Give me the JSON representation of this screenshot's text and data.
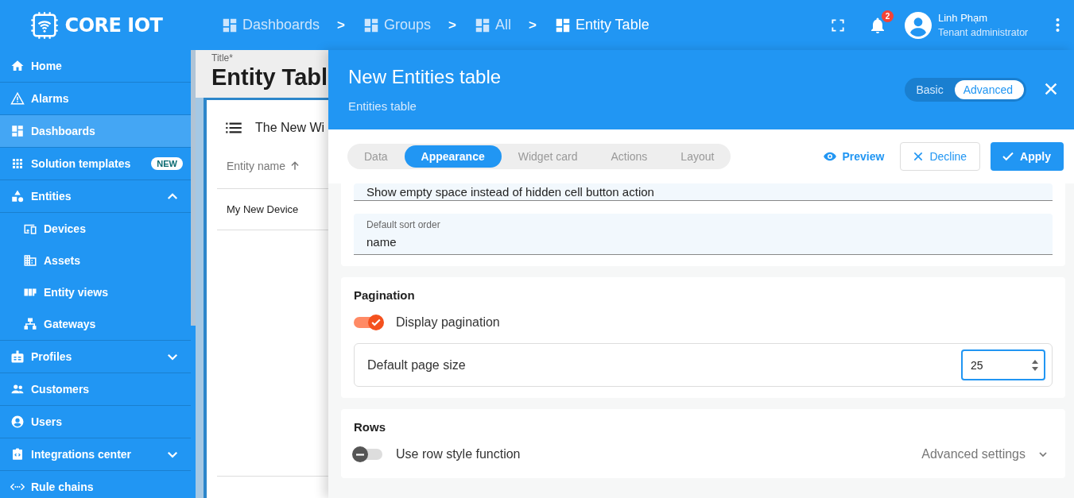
{
  "header": {
    "logo_text": "CORE IOT",
    "breadcrumbs": [
      {
        "label": "Dashboards",
        "current": false
      },
      {
        "label": "Groups",
        "current": false
      },
      {
        "label": "All",
        "current": false
      },
      {
        "label": "Entity Table",
        "current": true
      }
    ],
    "breadcrumb_separators": [
      ">",
      ">",
      ">"
    ],
    "notification_count": "2",
    "user": {
      "name": "Linh Phạm",
      "role": "Tenant administrator"
    }
  },
  "sidebar": {
    "items": [
      {
        "label": "Home",
        "selected": false
      },
      {
        "label": "Alarms",
        "selected": false
      },
      {
        "label": "Dashboards",
        "selected": true
      },
      {
        "label": "Solution templates",
        "selected": false,
        "badge": "NEW"
      },
      {
        "label": "Entities",
        "selected": false,
        "expanded": true,
        "children": [
          {
            "label": "Devices",
            "selected": false
          },
          {
            "label": "Assets",
            "selected": false
          },
          {
            "label": "Entity views",
            "selected": false
          },
          {
            "label": "Gateways",
            "selected": false
          }
        ]
      },
      {
        "label": "Profiles",
        "selected": false,
        "expanded": false
      },
      {
        "label": "Customers",
        "selected": false
      },
      {
        "label": "Users",
        "selected": false
      },
      {
        "label": "Integrations center",
        "selected": false,
        "expanded": false
      },
      {
        "label": "Rule chains",
        "selected": false
      }
    ]
  },
  "editor": {
    "title_label": "Title*",
    "title": "Entity Tabl",
    "widget_title": "The New Wi",
    "columns": [
      {
        "label": "Entity name",
        "sort_ascending": true
      }
    ],
    "rows": [
      [
        "My New Device"
      ]
    ]
  },
  "panel": {
    "title": "New Entities table",
    "subtitle": "Entities table",
    "modes": [
      {
        "label": "Basic",
        "selected": false
      },
      {
        "label": "Advanced",
        "selected": true
      }
    ],
    "tabs": [
      {
        "label": "Data",
        "selected": false
      },
      {
        "label": "Appearance",
        "selected": true
      },
      {
        "label": "Widget card",
        "selected": false
      },
      {
        "label": "Actions",
        "selected": false
      },
      {
        "label": "Layout",
        "selected": false
      }
    ],
    "actions": [
      {
        "label": "Preview",
        "kind": "link"
      },
      {
        "label": "Decline",
        "kind": "outline"
      },
      {
        "label": "Apply",
        "kind": "primary"
      }
    ],
    "sections": [
      {
        "items": [
          {
            "kind": "field",
            "value": "Show empty space instead of hidden cell button action"
          },
          {
            "kind": "field",
            "label": "Default sort order",
            "value": "name"
          }
        ]
      },
      {
        "title": "Pagination",
        "items": [
          {
            "kind": "toggle",
            "label": "Display pagination",
            "on": true
          },
          {
            "kind": "number",
            "label": "Default page size",
            "value": "25"
          }
        ]
      },
      {
        "title": "Rows",
        "items": [
          {
            "kind": "toggle",
            "label": "Use row style function",
            "on": false,
            "extra": {
              "label": "Advanced settings",
              "expanded": false
            }
          }
        ]
      }
    ]
  }
}
